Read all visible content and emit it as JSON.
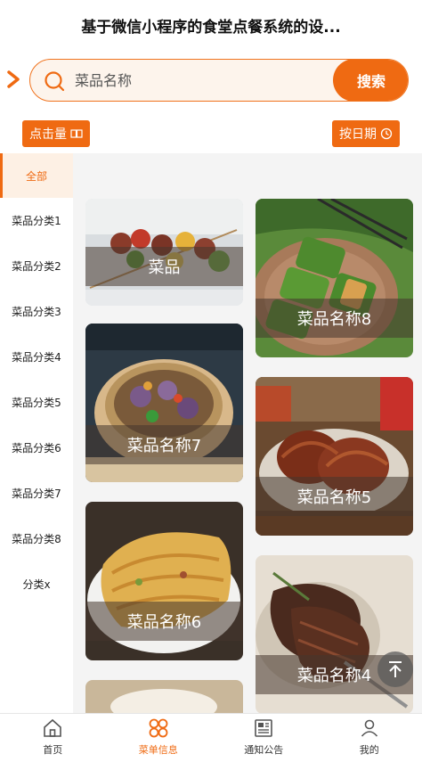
{
  "header": {
    "title": "基于微信小程序的食堂点餐系统的设..."
  },
  "search": {
    "placeholder": "菜品名称",
    "button_label": "搜索"
  },
  "sort": {
    "clicks_label": "点击量",
    "date_label": "按日期"
  },
  "sidebar": {
    "items": [
      {
        "label": "全部",
        "active": true
      },
      {
        "label": "菜品分类1"
      },
      {
        "label": "菜品分类2"
      },
      {
        "label": "菜品分类3"
      },
      {
        "label": "菜品分类4"
      },
      {
        "label": "菜品分类5"
      },
      {
        "label": "菜品分类6"
      },
      {
        "label": "菜品分类7"
      },
      {
        "label": "菜品分类8"
      },
      {
        "label": "分类x"
      }
    ]
  },
  "dishes": {
    "left": [
      {
        "name": "菜品"
      },
      {
        "name": "菜品名称7"
      },
      {
        "name": "菜品名称6"
      }
    ],
    "right": [
      {
        "name": "菜品名称8"
      },
      {
        "name": "菜品名称5"
      },
      {
        "name": "菜品名称4"
      }
    ]
  },
  "tabbar": {
    "items": [
      {
        "label": "首页",
        "icon": "home-icon"
      },
      {
        "label": "菜单信息",
        "icon": "menu-grid-icon",
        "active": true
      },
      {
        "label": "通知公告",
        "icon": "newspaper-icon"
      },
      {
        "label": "我的",
        "icon": "user-icon"
      }
    ]
  },
  "colors": {
    "accent": "#ef6a12",
    "accent_light": "#fdf0e4"
  }
}
